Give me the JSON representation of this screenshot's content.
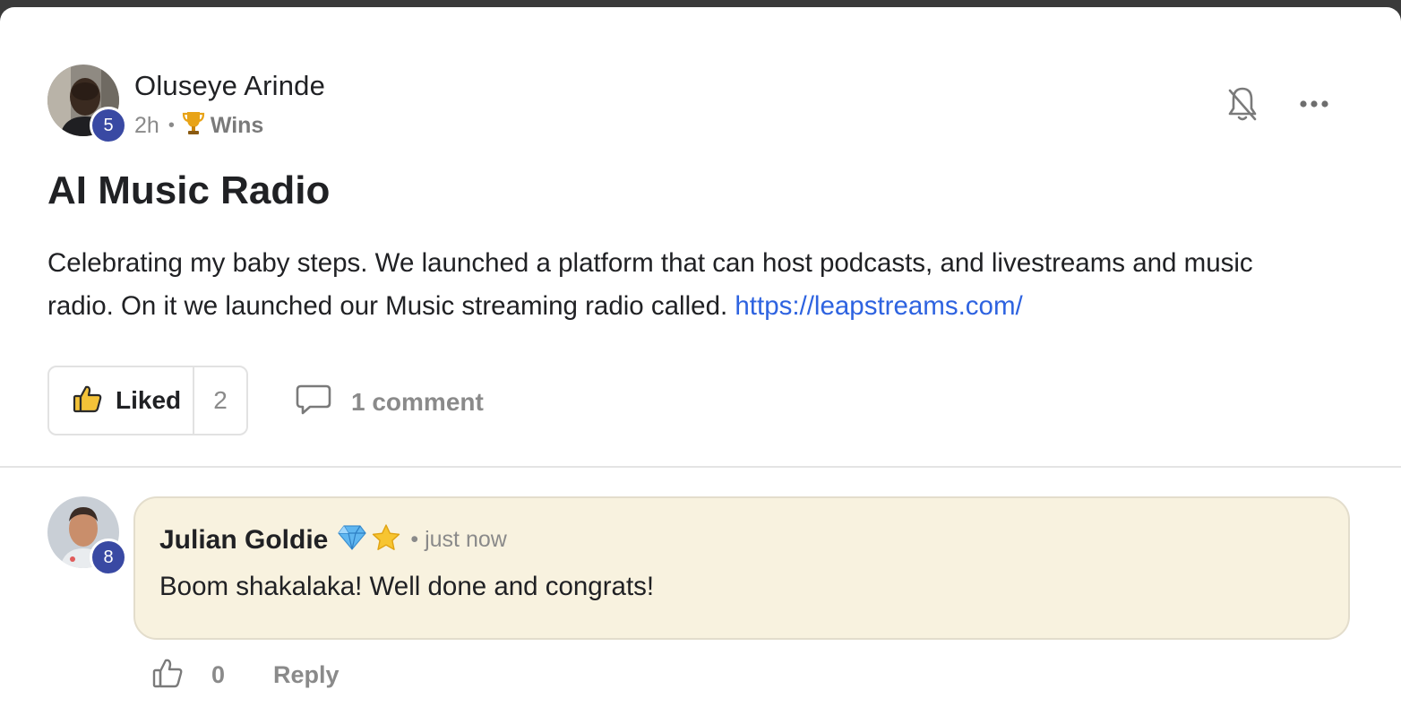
{
  "post": {
    "author": {
      "name": "Oluseye Arinde",
      "level": "5",
      "avatar_icon": "avatar-photo-icon"
    },
    "time": "2h",
    "separator": "•",
    "category": {
      "label": "Wins",
      "icon": "trophy-icon"
    },
    "actions": {
      "notifications_icon": "bell-off-icon",
      "more_icon": "more-options-icon"
    },
    "title": "AI Music Radio",
    "body_text": "Celebrating my baby steps. We launched a platform that can host podcasts, and livestreams and music radio. On it we launched our Music streaming radio called.",
    "link_text": "https://leapstreams.com/",
    "like": {
      "label": "Liked",
      "count": "2",
      "icon": "thumbs-up-filled-icon"
    },
    "comments": {
      "label": "1 comment",
      "icon": "comment-icon"
    }
  },
  "comment": {
    "author": {
      "name": "Julian Goldie",
      "level": "8",
      "badges": [
        "diamond-icon",
        "star-icon"
      ]
    },
    "separator": "•",
    "time": "just now",
    "text": "Boom shakalaka! Well done and congrats!",
    "like_count": "0",
    "reply_label": "Reply"
  },
  "colors": {
    "level_badge": "#3949a3",
    "link": "#2e63e0",
    "comment_bg": "#f8f2df",
    "muted_text": "#8a8a8a"
  }
}
